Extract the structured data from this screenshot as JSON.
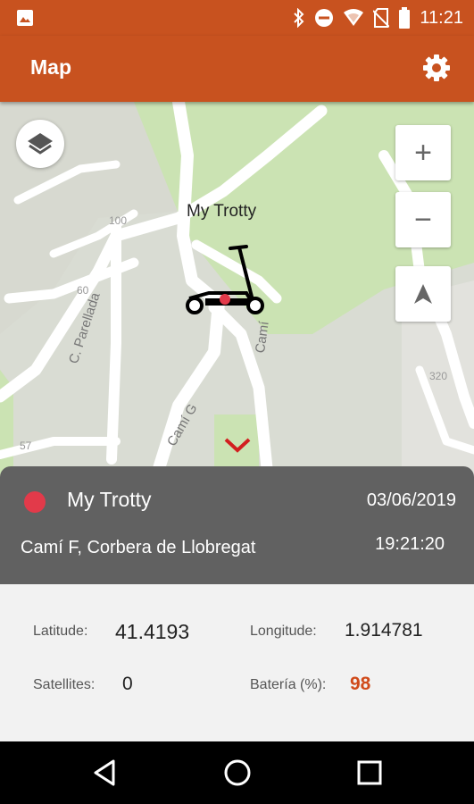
{
  "status_bar": {
    "time": "11:21",
    "icons": [
      "image-icon",
      "bluetooth-icon",
      "do-not-disturb-icon",
      "wifi-icon",
      "no-sim-icon",
      "battery-icon"
    ]
  },
  "app_bar": {
    "title": "Map",
    "settings_icon": "gear-icon"
  },
  "map": {
    "marker_label": "My Trotty",
    "streets": [
      "C. Parellada",
      "Camí G",
      "Camí"
    ],
    "numbers": [
      "100",
      "60",
      "57",
      "320"
    ],
    "controls": {
      "zoom_in": "+",
      "zoom_out": "−"
    }
  },
  "panel": {
    "device_name": "My Trotty",
    "date": "03/06/2019",
    "address": "Camí F, Corbera de Llobregat",
    "time": "19:21:20",
    "latitude_label": "Latitude:",
    "latitude": "41.4193",
    "longitude_label": "Longitude:",
    "longitude": "1.914781",
    "satellites_label": "Satellites:",
    "satellites": "0",
    "battery_label": "Batería (%):",
    "battery": "98"
  },
  "colors": {
    "accent": "#c8521f",
    "panel_header": "#616161",
    "status_dot": "#e23a4a",
    "battery_value": "#d04a1a",
    "park_green": "#cbe3b3"
  }
}
